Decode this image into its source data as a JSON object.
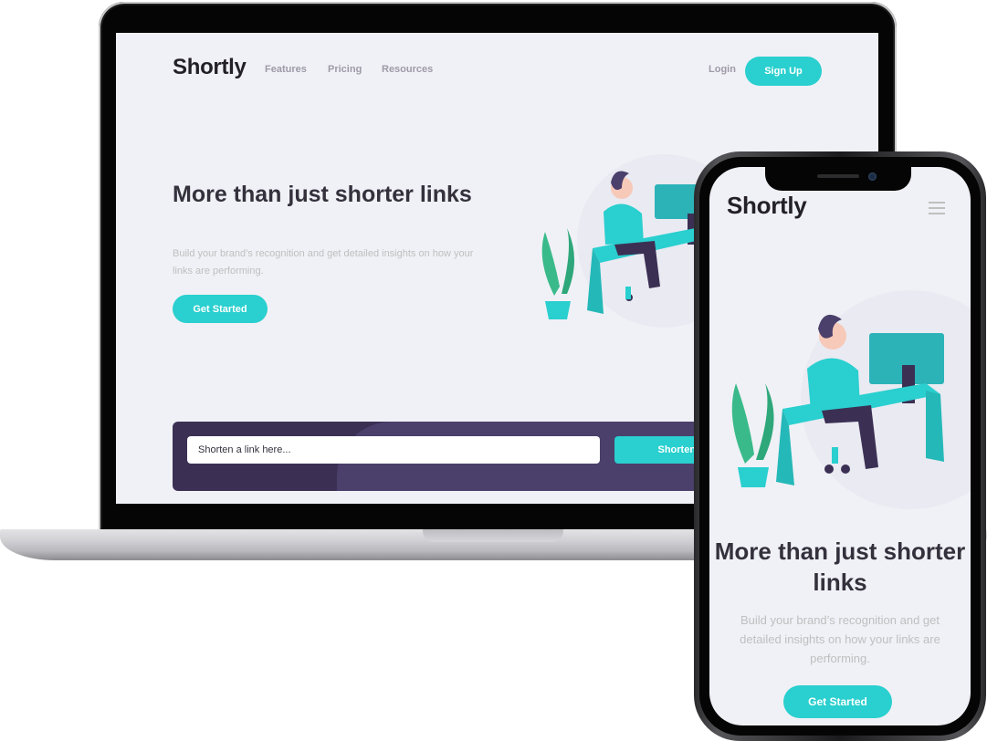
{
  "brand": {
    "primary": "#2acfcf",
    "dark_violet": "#3b3054",
    "heading": "#34313d",
    "gray": "#bfbfbf"
  },
  "desktop": {
    "logo": "Shortly",
    "nav": [
      "Features",
      "Pricing",
      "Resources"
    ],
    "login": "Login",
    "signup": "Sign Up",
    "headline": "More than just shorter links",
    "subtext": "Build your brand’s recognition and get detailed insights on how your links are performing.",
    "cta": "Get Started",
    "shorten": {
      "placeholder": "Shorten a link here...",
      "button": "Shorten It!"
    }
  },
  "mobile": {
    "logo": "Shortly",
    "menu_icon": "hamburger-menu-icon",
    "headline": "More than just shorter links",
    "subtext": "Build your brand’s recognition and get detailed insights on how your links are performing.",
    "cta": "Get Started"
  }
}
